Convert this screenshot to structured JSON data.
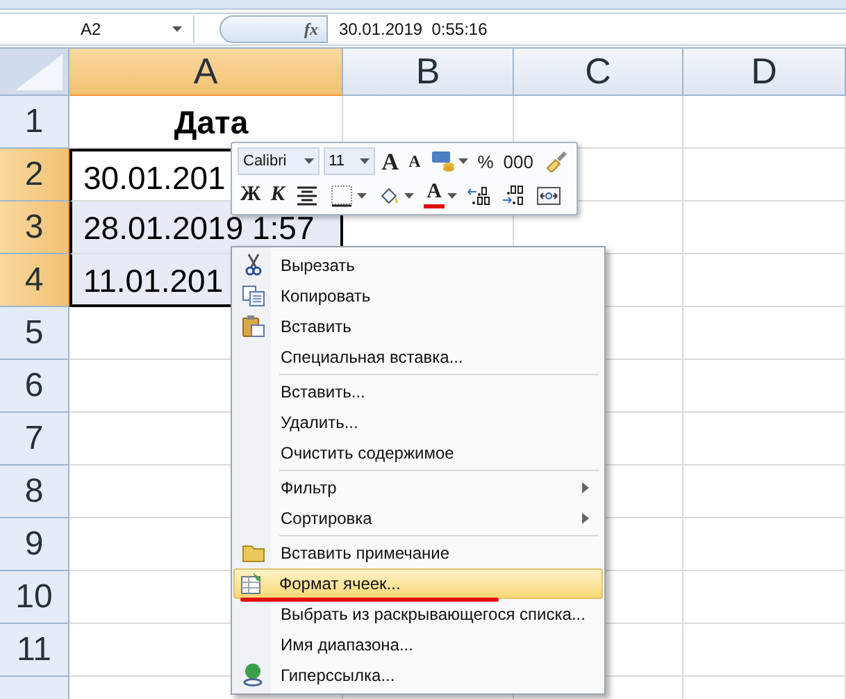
{
  "formula_bar": {
    "name_box": "A2",
    "fx": "fx",
    "value": "30.01.2019  0:55:16"
  },
  "columns": [
    {
      "label": "A",
      "selected": true
    },
    {
      "label": "B",
      "selected": false
    },
    {
      "label": "C",
      "selected": false
    },
    {
      "label": "D",
      "selected": false
    }
  ],
  "rows": [
    {
      "header": "1",
      "selected": false,
      "cells": [
        {
          "text": "Дата",
          "bold": true,
          "shaded": false
        }
      ]
    },
    {
      "header": "2",
      "selected": true,
      "cells": [
        {
          "text": "30.01.201",
          "bold": false,
          "shaded": false
        }
      ]
    },
    {
      "header": "3",
      "selected": true,
      "cells": [
        {
          "text": "28.01.2019 1:57",
          "bold": false,
          "shaded": true
        }
      ]
    },
    {
      "header": "4",
      "selected": true,
      "cells": [
        {
          "text": "11.01.201",
          "bold": false,
          "shaded": true
        }
      ]
    },
    {
      "header": "5",
      "selected": false,
      "cells": []
    },
    {
      "header": "6",
      "selected": false,
      "cells": []
    },
    {
      "header": "7",
      "selected": false,
      "cells": []
    },
    {
      "header": "8",
      "selected": false,
      "cells": []
    },
    {
      "header": "9",
      "selected": false,
      "cells": []
    },
    {
      "header": "10",
      "selected": false,
      "cells": []
    },
    {
      "header": "11",
      "selected": false,
      "cells": []
    }
  ],
  "mini_toolbar": {
    "font_name": "Calibri",
    "font_size": "11",
    "grow_font": "A",
    "shrink_font": "A",
    "percent": "%",
    "thousands": "000",
    "bold": "Ж",
    "italic": "К",
    "font_color": "A"
  },
  "context_menu": [
    {
      "kind": "item",
      "label": "Вырезать",
      "submenu": false,
      "selected": false,
      "annotated": false
    },
    {
      "kind": "item",
      "label": "Копировать",
      "submenu": false,
      "selected": false,
      "annotated": false
    },
    {
      "kind": "item",
      "label": "Вставить",
      "submenu": false,
      "selected": false,
      "annotated": false
    },
    {
      "kind": "item",
      "label": "Специальная вставка...",
      "submenu": false,
      "selected": false,
      "annotated": false
    },
    {
      "kind": "separator"
    },
    {
      "kind": "item",
      "label": "Вставить...",
      "submenu": false,
      "selected": false,
      "annotated": false
    },
    {
      "kind": "item",
      "label": "Удалить...",
      "submenu": false,
      "selected": false,
      "annotated": false
    },
    {
      "kind": "item",
      "label": "Очистить содержимое",
      "submenu": false,
      "selected": false,
      "annotated": false
    },
    {
      "kind": "separator"
    },
    {
      "kind": "item",
      "label": "Фильтр",
      "submenu": true,
      "selected": false,
      "annotated": false
    },
    {
      "kind": "item",
      "label": "Сортировка",
      "submenu": true,
      "selected": false,
      "annotated": false
    },
    {
      "kind": "separator"
    },
    {
      "kind": "item",
      "label": "Вставить примечание",
      "submenu": false,
      "selected": false,
      "annotated": false
    },
    {
      "kind": "item",
      "label": "Формат ячеек...",
      "submenu": false,
      "selected": true,
      "annotated": true
    },
    {
      "kind": "item",
      "label": "Выбрать из раскрывающегося списка...",
      "submenu": false,
      "selected": false,
      "annotated": false
    },
    {
      "kind": "item",
      "label": "Имя диапазона...",
      "submenu": false,
      "selected": false,
      "annotated": false
    },
    {
      "kind": "item",
      "label": "Гиперссылка...",
      "submenu": false,
      "selected": false,
      "annotated": false
    }
  ]
}
